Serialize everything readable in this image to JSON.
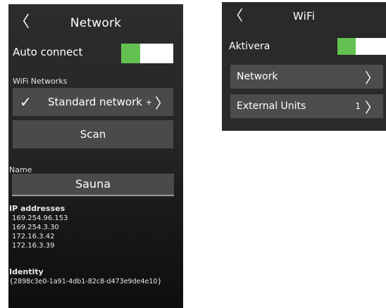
{
  "network_screen": {
    "back_icon": "chevron-left-icon",
    "title": "Network",
    "auto_connect_label": "Auto connect",
    "auto_connect_on": true,
    "wifi_networks_label": "WiFi Networks",
    "selected_network": "Standard network",
    "selected_network_suffix": "+",
    "scan_label": "Scan",
    "name_label": "Name",
    "name_value": "Sauna",
    "ip_heading": "IP addresses",
    "ip_addresses": [
      "169.254.96.153",
      "169.254.3.30",
      "172.16.3.42",
      "172.16.3.39"
    ],
    "identity_heading": "Identity",
    "identity_value": "{2898c3e0-1a91-4db1-82c8-d473e9de4e10}"
  },
  "wifi_screen": {
    "back_icon": "chevron-left-icon",
    "title": "WiFi",
    "activate_label": "Aktivera",
    "activate_on": true,
    "rows": [
      {
        "label": "Network",
        "count": ""
      },
      {
        "label": "External Units",
        "count": "1"
      }
    ]
  },
  "colors": {
    "toggle_on": "#63c152",
    "toggle_off": "#ffffff",
    "panel_bg": "#2a2a2a",
    "button_bg": "#4a4a4a"
  }
}
